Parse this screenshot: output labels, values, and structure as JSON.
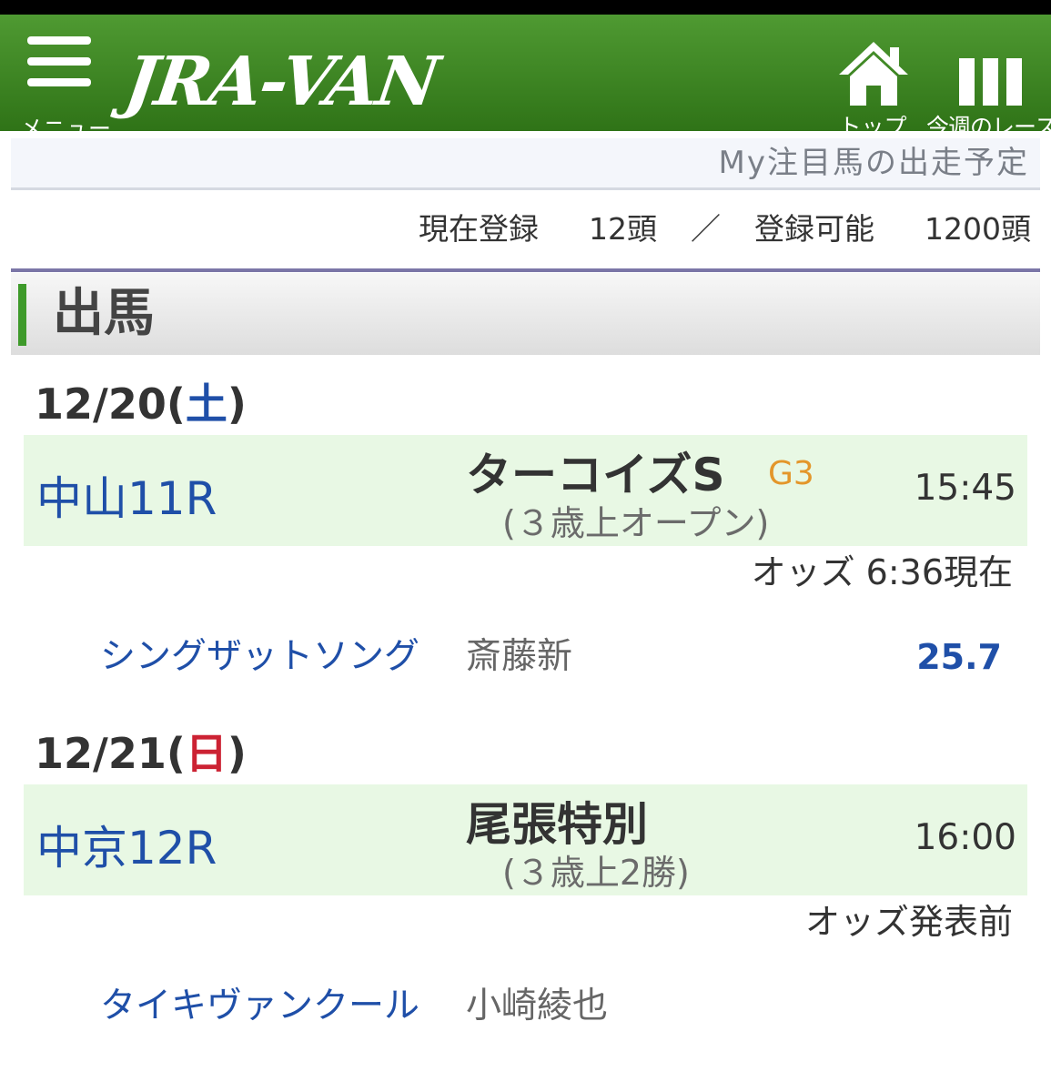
{
  "header": {
    "menu_label": "メニュー",
    "logo": "JRA-VAN",
    "top_label": "トップ",
    "week_label": "今週のレース"
  },
  "subbar": {
    "title": "My注目馬の出走予定"
  },
  "registration": {
    "current_label": "現在登録",
    "current_count": "12頭",
    "separator": "／",
    "capacity_label": "登録可能",
    "capacity_count": "1200頭"
  },
  "section": {
    "title": "出馬"
  },
  "days": [
    {
      "date": "12/20",
      "dow": "土",
      "race": {
        "venue": "中山11R",
        "name": "ターコイズS",
        "grade": "G3",
        "class": "(３歳上オープン)",
        "time": "15:45"
      },
      "odds_note": "オッズ 6:36現在",
      "horse": {
        "name": "シングザットソング",
        "jockey": "斎藤新",
        "odds": "25.7"
      }
    },
    {
      "date": "12/21",
      "dow": "日",
      "race": {
        "venue": "中京12R",
        "name": "尾張特別",
        "grade": "",
        "class": "(３歳上2勝)",
        "time": "16:00"
      },
      "odds_note": "オッズ発表前",
      "horse": {
        "name": "タイキヴァンクール",
        "jockey": "小崎綾也",
        "odds": ""
      }
    }
  ],
  "colors": {
    "header_green": "#3f8a24",
    "venue_blue": "#1f4fa8",
    "sunday_red": "#cc2233",
    "grade_orange": "#e3962a",
    "race_bg": "#e8f8e4"
  }
}
